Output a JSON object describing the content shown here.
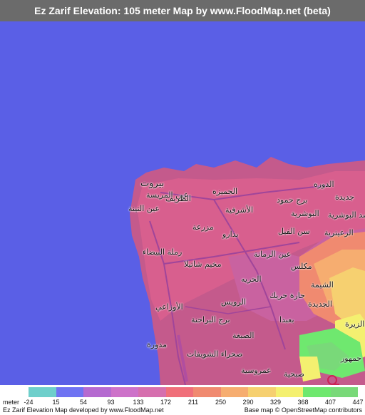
{
  "title": "Ez Zarif Elevation: 105 meter Map by www.FloodMap.net (beta)",
  "colors": {
    "sea": "#5a5fe6",
    "title_bar": "#6b6b6b",
    "marker": "#cc2255"
  },
  "places": [
    {
      "name": "بيروت",
      "big": true
    },
    {
      "name": "عين المريسة"
    },
    {
      "name": "الجميزه"
    },
    {
      "name": "الظريف"
    },
    {
      "name": "عين التينة"
    },
    {
      "name": "الأشرفية"
    },
    {
      "name": "برج حمود"
    },
    {
      "name": "الدوره"
    },
    {
      "name": "جديدة"
    },
    {
      "name": "البوشرية"
    },
    {
      "name": "سد البوشرية"
    },
    {
      "name": "مزرعة"
    },
    {
      "name": "بدارو"
    },
    {
      "name": "سن الفيل"
    },
    {
      "name": "رملة البيضاء"
    },
    {
      "name": "عين الرمانة"
    },
    {
      "name": "الزعيترية"
    },
    {
      "name": "مخيم شاتيلا"
    },
    {
      "name": "مكلس"
    },
    {
      "name": "الحريه"
    },
    {
      "name": "الشيمة"
    },
    {
      "name": "الأوزاعي"
    },
    {
      "name": "الرويس"
    },
    {
      "name": "حارة حريك"
    },
    {
      "name": "الجديدة"
    },
    {
      "name": "برج البراجنة"
    },
    {
      "name": "الزيرة"
    },
    {
      "name": "بعبدا"
    },
    {
      "name": "الصبغة"
    },
    {
      "name": "مدورة"
    },
    {
      "name": "صحراء الشويفات"
    },
    {
      "name": "عمروسية"
    },
    {
      "name": "صبحية"
    },
    {
      "name": "جمهور"
    }
  ],
  "legend": {
    "unit_label": "meter",
    "ticks": [
      "-24",
      "15",
      "54",
      "93",
      "133",
      "172",
      "211",
      "250",
      "290",
      "329",
      "368",
      "407",
      "447"
    ],
    "colors": [
      "#6ecfcb",
      "#6f73f2",
      "#b56ad0",
      "#cd72c9",
      "#d66fae",
      "#f06f7a",
      "#f08a70",
      "#f6ad70",
      "#f6d070",
      "#f4f070",
      "#6fe86f",
      "#79d979"
    ]
  },
  "footer": {
    "left": "Ez Zarif Elevation Map developed by www.FloodMap.net",
    "right": "Base map © OpenStreetMap contributors"
  }
}
